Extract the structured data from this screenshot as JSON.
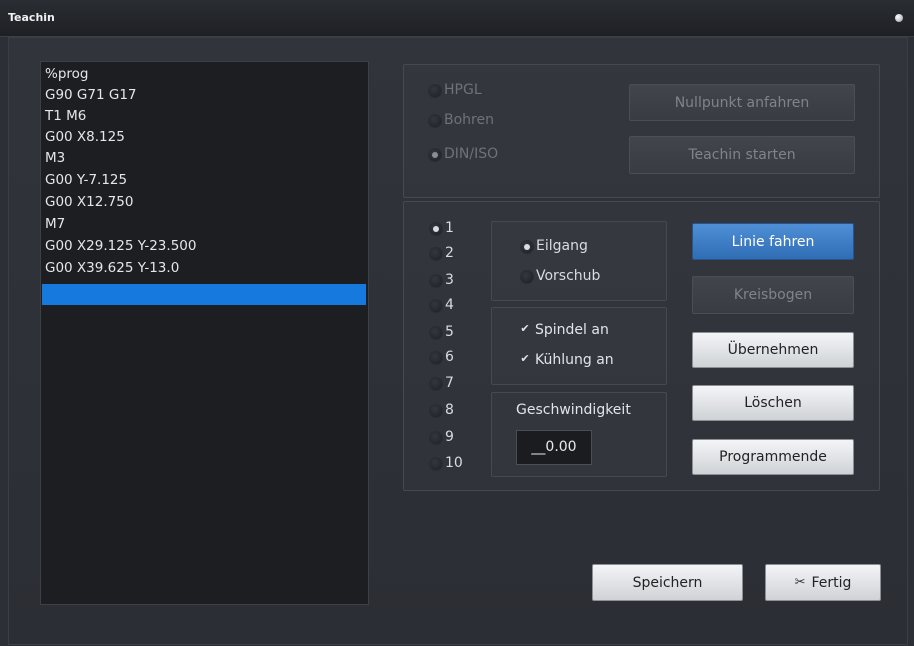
{
  "window": {
    "title": "Teachin"
  },
  "program": {
    "lines": [
      "%prog",
      "G90 G71 G17",
      "T1 M6",
      "G00 X8.125",
      "M3",
      "G00 Y-7.125",
      "G00 X12.750",
      "M7",
      "G00 X29.125 Y-23.500",
      "G00 X39.625 Y-13.0",
      ""
    ]
  },
  "mode": {
    "options": [
      "HPGL",
      "Bohren",
      "DIN/ISO"
    ],
    "selected": "DIN/ISO",
    "nullpunkt_label": "Nullpunkt anfahren",
    "teachin_start_label": "Teachin starten"
  },
  "axis": {
    "options": [
      "1",
      "2",
      "3",
      "4",
      "5",
      "6",
      "7",
      "8",
      "9",
      "10"
    ],
    "selected": "1"
  },
  "motion": {
    "eilgang_label": "Eilgang",
    "vorschub_label": "Vorschub",
    "selected": "Eilgang"
  },
  "switches": {
    "spindel_label": "Spindel an",
    "spindel_checked": true,
    "kuehlung_label": "Kühlung an",
    "kuehlung_checked": true
  },
  "speed": {
    "label": "Geschwindigkeit",
    "value": "__0.00"
  },
  "actions": {
    "linie_label": "Linie fahren",
    "kreisbogen_label": "Kreisbogen",
    "uebernehmen_label": "Übernehmen",
    "loeschen_label": "Löschen",
    "programmende_label": "Programmende"
  },
  "footer": {
    "speichern_label": "Speichern",
    "fertig_label": "Fertig"
  },
  "colors": {
    "selection": "#1679dd",
    "primary_button": "#3a78c0",
    "background": "#2c2f35"
  }
}
